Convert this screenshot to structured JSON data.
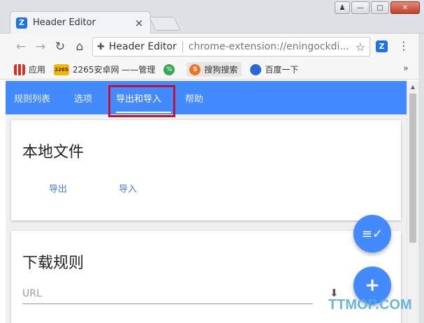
{
  "window": {
    "tab_title": "Header Editor",
    "tab_icon": "Z",
    "tab_close": "×",
    "user_glyph": "♟",
    "minimize_glyph": "—",
    "maximize_glyph": "□",
    "close_glyph": "✕"
  },
  "toolbar": {
    "back_glyph": "←",
    "forward_glyph": "→",
    "reload_glyph": "↻",
    "home_glyph": "⌂",
    "extension_glyph": "✚",
    "site_name": "Header Editor",
    "url": "chrome-extension://eningockdi...",
    "star_glyph": "☆",
    "ext_icon": "Z",
    "menu_glyph": "⋮"
  },
  "bookmarks": {
    "items": [
      {
        "label": "应用",
        "icon": "apps-icon",
        "glyph": ""
      },
      {
        "label": "2265安卓网 ——管理",
        "icon": "2265-icon",
        "glyph": "2265"
      },
      {
        "label": "",
        "icon": "green-site-icon",
        "glyph": "%"
      },
      {
        "label": "搜狗搜索",
        "icon": "sogou-icon",
        "glyph": "S"
      },
      {
        "label": "百度一下",
        "icon": "baidu-icon",
        "glyph": "🐾"
      }
    ],
    "more_glyph": "»"
  },
  "app": {
    "accent": "#448aff",
    "tabs": [
      {
        "label": "规则列表"
      },
      {
        "label": "选项"
      },
      {
        "label": "导出和导入"
      },
      {
        "label": "帮助"
      }
    ],
    "local_card": {
      "title": "本地文件",
      "export_label": "导出",
      "import_label": "导入"
    },
    "download_card": {
      "title": "下载规则",
      "url_placeholder": "URL",
      "download_glyph": "⬇"
    },
    "fab_list_glyph": "≡✓",
    "fab_add_glyph": "+"
  },
  "scroll": {
    "up_glyph": "▲"
  },
  "watermark": "TTMOP.COM"
}
